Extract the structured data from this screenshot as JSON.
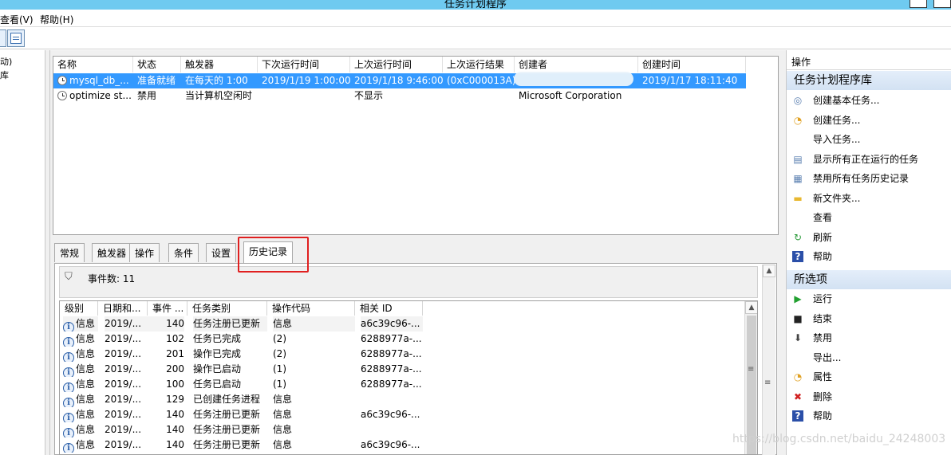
{
  "window": {
    "title": "任务计划程序"
  },
  "menu": {
    "view": "查看(V)",
    "help": "帮助(H)"
  },
  "tree": {
    "item1": "动)",
    "item2": "库"
  },
  "task_columns": [
    "名称",
    "状态",
    "触发器",
    "下次运行时间",
    "上次运行时间",
    "上次运行结果",
    "创建者",
    "创建时间"
  ],
  "tasks": [
    {
      "name": "mysql_db_...",
      "status": "准备就绪",
      "trigger": "在每天的 1:00",
      "next_run": "2019/1/19 1:00:00",
      "last_run": "2019/1/18 9:46:00",
      "last_result": "(0xC000013A)",
      "author": "",
      "created": "2019/1/17 18:11:40",
      "selected": true
    },
    {
      "name": "optimize st...",
      "status": "禁用",
      "trigger": "当计算机空闲时",
      "next_run": "",
      "last_run": "不显示",
      "last_result": "",
      "author": "Microsoft Corporation",
      "created": "",
      "selected": false
    }
  ],
  "detail_tabs": [
    "常规",
    "触发器",
    "操作",
    "条件",
    "设置",
    "历史记录"
  ],
  "active_tab": "历史记录",
  "filter": {
    "event_count_label": "事件数: 11"
  },
  "event_columns": [
    "级别",
    "日期和...",
    "事件 ...",
    "任务类别",
    "操作代码",
    "相关 ID"
  ],
  "events": [
    {
      "level": "信息",
      "date": "2019/...",
      "event_id": "140",
      "category": "任务注册已更新",
      "opcode": "信息",
      "related_id": "a6c39c96-..."
    },
    {
      "level": "信息",
      "date": "2019/...",
      "event_id": "102",
      "category": "任务已完成",
      "opcode": "(2)",
      "related_id": "6288977a-..."
    },
    {
      "level": "信息",
      "date": "2019/...",
      "event_id": "201",
      "category": "操作已完成",
      "opcode": "(2)",
      "related_id": "6288977a-..."
    },
    {
      "level": "信息",
      "date": "2019/...",
      "event_id": "200",
      "category": "操作已启动",
      "opcode": "(1)",
      "related_id": "6288977a-..."
    },
    {
      "level": "信息",
      "date": "2019/...",
      "event_id": "100",
      "category": "任务已启动",
      "opcode": "(1)",
      "related_id": "6288977a-..."
    },
    {
      "level": "信息",
      "date": "2019/...",
      "event_id": "129",
      "category": "已创建任务进程",
      "opcode": "信息",
      "related_id": ""
    },
    {
      "level": "信息",
      "date": "2019/...",
      "event_id": "140",
      "category": "任务注册已更新",
      "opcode": "信息",
      "related_id": "a6c39c96-..."
    },
    {
      "level": "信息",
      "date": "2019/...",
      "event_id": "140",
      "category": "任务注册已更新",
      "opcode": "信息",
      "related_id": ""
    },
    {
      "level": "信息",
      "date": "2019/...",
      "event_id": "140",
      "category": "任务注册已更新",
      "opcode": "信息",
      "related_id": "a6c39c96-..."
    }
  ],
  "actions_pane": {
    "title": "操作",
    "section1": "任务计划程序库",
    "items1": [
      {
        "label": "创建基本任务...",
        "icon": "create-basic-task-icon",
        "glyph": "◎",
        "color": "#5a7fb0"
      },
      {
        "label": "创建任务...",
        "icon": "create-task-icon",
        "glyph": "◔",
        "color": "#e0a020"
      },
      {
        "label": "导入任务...",
        "icon": "",
        "glyph": "",
        "color": "#000000"
      },
      {
        "label": "显示所有正在运行的任务",
        "icon": "running-tasks-icon",
        "glyph": "▤",
        "color": "#5a7fb0"
      },
      {
        "label": "禁用所有任务历史记录",
        "icon": "history-icon",
        "glyph": "▦",
        "color": "#5a7fb0"
      },
      {
        "label": "新文件夹...",
        "icon": "folder-icon",
        "glyph": "▬",
        "color": "#e8b830"
      },
      {
        "label": "查看",
        "icon": "",
        "glyph": "",
        "color": "#000000"
      },
      {
        "label": "刷新",
        "icon": "refresh-icon",
        "glyph": "↻",
        "color": "#2a9a3a"
      },
      {
        "label": "帮助",
        "icon": "help-icon",
        "glyph": "?",
        "color": "#2b4fa8"
      }
    ],
    "section2": "所选项",
    "items2": [
      {
        "label": "运行",
        "icon": "run-icon",
        "glyph": "▶",
        "color": "#22a030"
      },
      {
        "label": "结束",
        "icon": "stop-icon",
        "glyph": "■",
        "color": "#222222"
      },
      {
        "label": "禁用",
        "icon": "disable-icon",
        "glyph": "⬇",
        "color": "#444444"
      },
      {
        "label": "导出...",
        "icon": "",
        "glyph": "",
        "color": "#000000"
      },
      {
        "label": "属性",
        "icon": "properties-icon",
        "glyph": "◔",
        "color": "#e0a020"
      },
      {
        "label": "删除",
        "icon": "delete-icon",
        "glyph": "✖",
        "color": "#d02020"
      },
      {
        "label": "帮助",
        "icon": "help-icon",
        "glyph": "?",
        "color": "#2b4fa8"
      }
    ]
  },
  "watermark": "https://blog.csdn.net/baidu_24248003"
}
